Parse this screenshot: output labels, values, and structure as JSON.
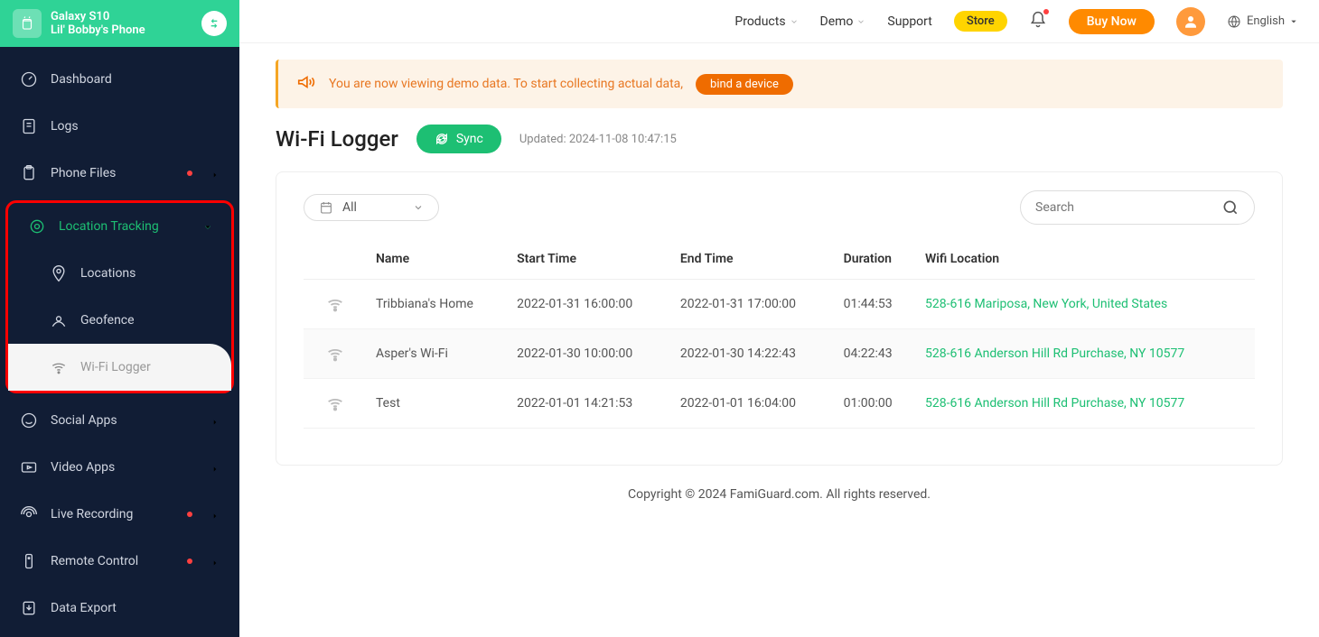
{
  "device": {
    "name": "Galaxy S10",
    "sub": "Lil' Bobby's Phone"
  },
  "sidebar": {
    "dashboard": "Dashboard",
    "logs": "Logs",
    "phone_files": "Phone Files",
    "location_tracking": "Location Tracking",
    "locations": "Locations",
    "geofence": "Geofence",
    "wifi_logger": "Wi-Fi Logger",
    "social_apps": "Social Apps",
    "video_apps": "Video Apps",
    "live_recording": "Live Recording",
    "remote_control": "Remote Control",
    "data_export": "Data Export"
  },
  "topbar": {
    "products": "Products",
    "demo": "Demo",
    "support": "Support",
    "store": "Store",
    "buy_now": "Buy Now",
    "language": "English"
  },
  "banner": {
    "text": "You are now viewing demo data. To start collecting actual data,",
    "button": "bind a device"
  },
  "page": {
    "title": "Wi-Fi Logger",
    "sync": "Sync",
    "updated": "Updated: 2024-11-08 10:47:15"
  },
  "filter": {
    "selected": "All"
  },
  "search": {
    "placeholder": "Search"
  },
  "table": {
    "headers": {
      "name": "Name",
      "start": "Start Time",
      "end": "End Time",
      "duration": "Duration",
      "location": "Wifi Location"
    },
    "rows": [
      {
        "name": "Tribbiana's Home",
        "start": "2022-01-31 16:00:00",
        "end": "2022-01-31 17:00:00",
        "duration": "01:44:53",
        "location": "528-616 Mariposa, New York, United States"
      },
      {
        "name": "Asper's Wi-Fi",
        "start": "2022-01-30 10:00:00",
        "end": "2022-01-30 14:22:43",
        "duration": "04:22:43",
        "location": "528-616 Anderson Hill Rd Purchase, NY 10577"
      },
      {
        "name": "Test",
        "start": "2022-01-01 14:21:53",
        "end": "2022-01-01 16:04:00",
        "duration": "01:00:00",
        "location": "528-616 Anderson Hill Rd Purchase, NY 10577"
      }
    ]
  },
  "footer": "Copyright © 2024 FamiGuard.com. All rights reserved."
}
